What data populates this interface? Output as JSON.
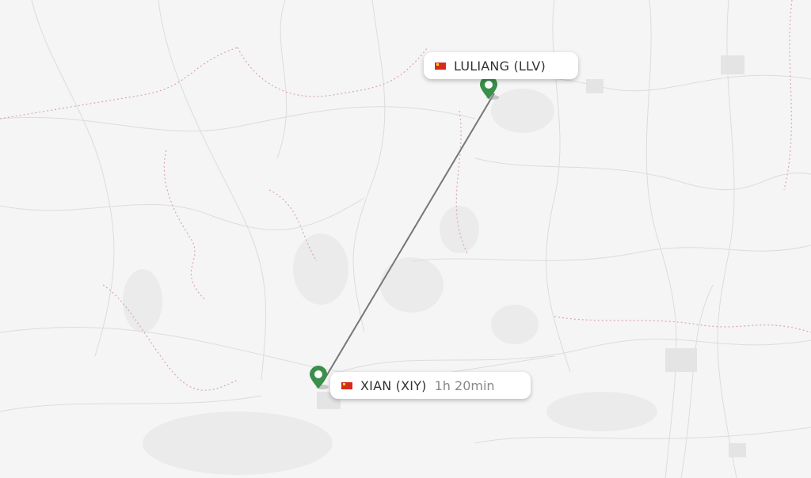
{
  "map": {
    "origin": {
      "city_label": "LULIANG (LLV)",
      "flag": "china-flag",
      "pin_color": "#3a8f4a"
    },
    "destination": {
      "city_label": "XIAN (XIY)",
      "flag": "china-flag",
      "duration": "1h 20min",
      "pin_color": "#3a8f4a"
    },
    "route_color": "#777777",
    "background_color": "#f5f5f5"
  }
}
